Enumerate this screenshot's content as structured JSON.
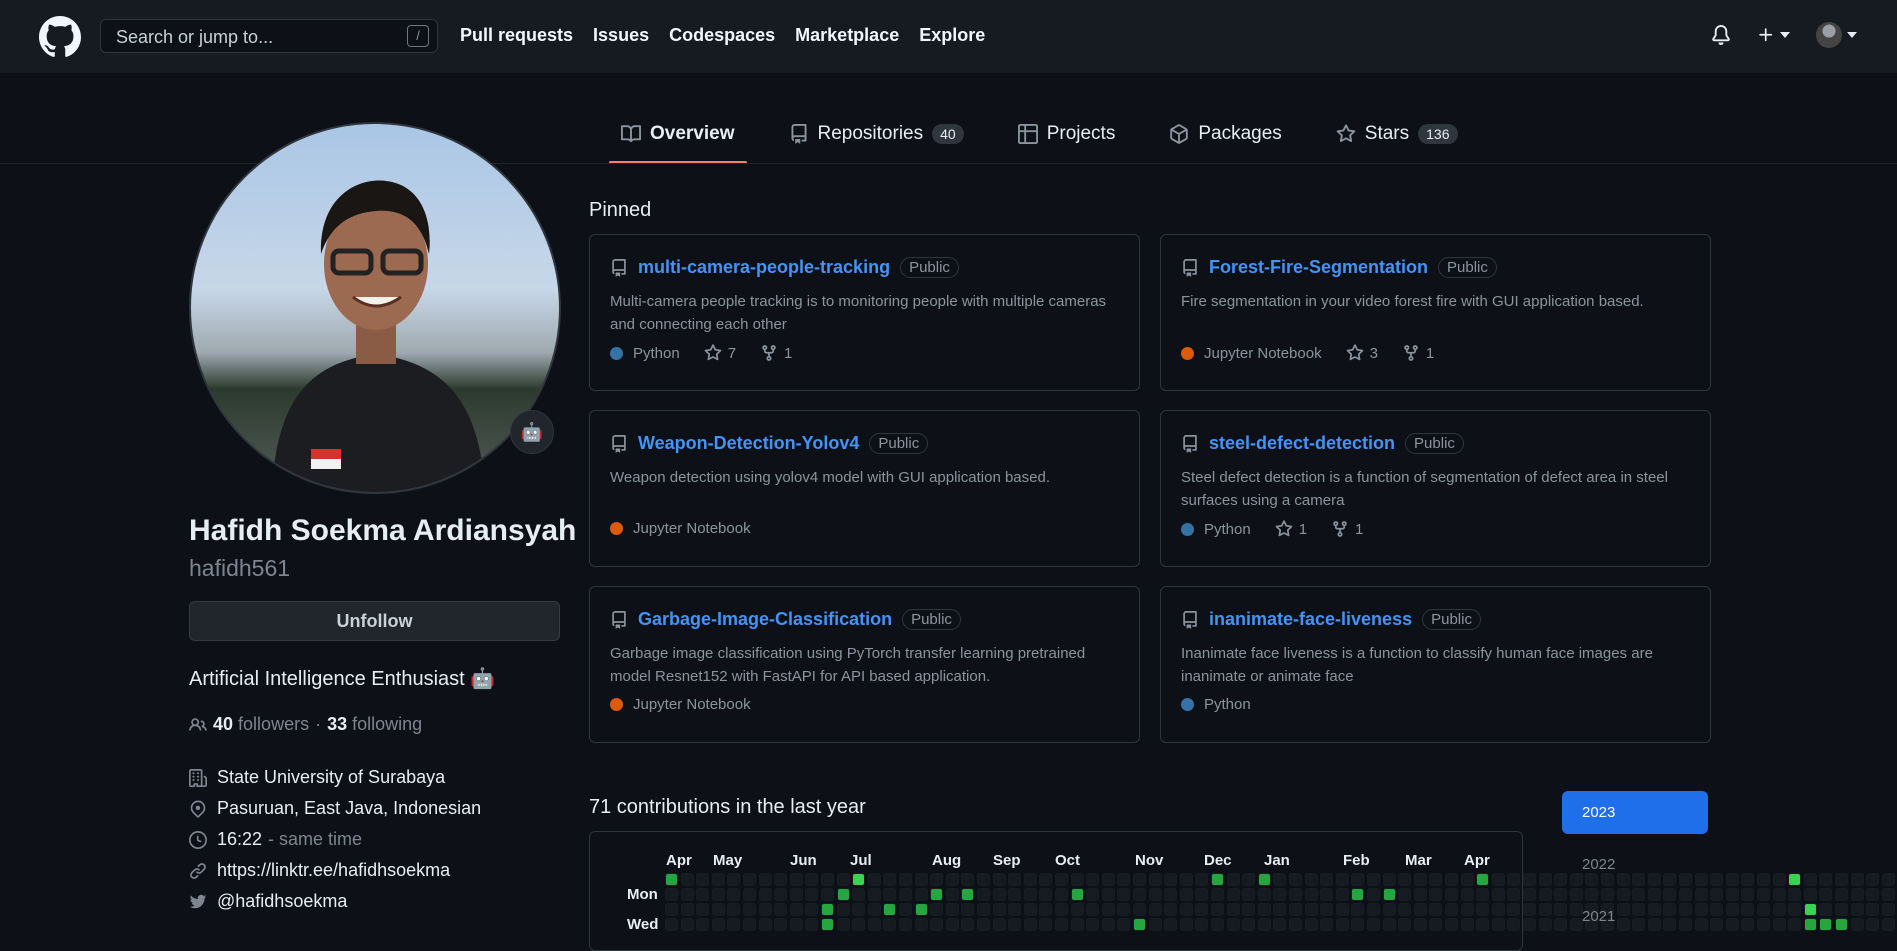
{
  "header": {
    "search_placeholder": "Search or jump to...",
    "search_key": "/",
    "nav": [
      "Pull requests",
      "Issues",
      "Codespaces",
      "Marketplace",
      "Explore"
    ]
  },
  "tabs": [
    {
      "label": "Overview",
      "icon": "book-icon"
    },
    {
      "label": "Repositories",
      "count": "40",
      "icon": "repo-icon"
    },
    {
      "label": "Projects",
      "icon": "table-icon"
    },
    {
      "label": "Packages",
      "icon": "package-icon"
    },
    {
      "label": "Stars",
      "count": "136",
      "icon": "star-icon"
    }
  ],
  "profile": {
    "name": "Hafidh Soekma Ardiansyah",
    "username": "hafidh561",
    "follow_button": "Unfollow",
    "bio": "Artificial Intelligence Enthusiast 🤖",
    "followers_count": "40",
    "followers_label": "followers",
    "separator": "·",
    "following_count": "33",
    "following_label": "following",
    "organization": "State University of Surabaya",
    "location": "Pasuruan, East Java, Indonesian",
    "local_time": "16:22",
    "time_note": "- same time",
    "website": "https://linktr.ee/hafidhsoekma",
    "twitter": "@hafidhsoekma"
  },
  "pinned": {
    "title": "Pinned",
    "repos": [
      {
        "name": "multi-camera-people-tracking",
        "visibility": "Public",
        "description": "Multi-camera people tracking is to monitoring people with multiple cameras and connecting each other",
        "language": "Python",
        "lang_color": "#3572A5",
        "stars": "7",
        "forks": "1"
      },
      {
        "name": "Forest-Fire-Segmentation",
        "visibility": "Public",
        "description": "Fire segmentation in your video forest fire with GUI application based.",
        "language": "Jupyter Notebook",
        "lang_color": "#DA5B0B",
        "stars": "3",
        "forks": "1"
      },
      {
        "name": "Weapon-Detection-Yolov4",
        "visibility": "Public",
        "description": "Weapon detection using yolov4 model with GUI application based.",
        "language": "Jupyter Notebook",
        "lang_color": "#DA5B0B",
        "stars": "",
        "forks": ""
      },
      {
        "name": "steel-defect-detection",
        "visibility": "Public",
        "description": "Steel defect detection is a function of segmentation of defect area in steel surfaces using a camera",
        "language": "Python",
        "lang_color": "#3572A5",
        "stars": "1",
        "forks": "1"
      },
      {
        "name": "Garbage-Image-Classification",
        "visibility": "Public",
        "description": "Garbage image classification using PyTorch transfer learning pretrained model Resnet152 with FastAPI for API based application.",
        "language": "Jupyter Notebook",
        "lang_color": "#DA5B0B",
        "stars": "",
        "forks": ""
      },
      {
        "name": "inanimate-face-liveness",
        "visibility": "Public",
        "description": "Inanimate face liveness is a function to classify human face images are inanimate or animate face",
        "language": "Python",
        "lang_color": "#3572A5",
        "stars": "",
        "forks": ""
      }
    ]
  },
  "contributions": {
    "title": "71 contributions in the last year",
    "months": [
      "Apr",
      "May",
      "Jun",
      "Jul",
      "Aug",
      "Sep",
      "Oct",
      "Nov",
      "Dec",
      "Jan",
      "Feb",
      "Mar",
      "Apr"
    ],
    "days": [
      "Mon",
      "Wed"
    ],
    "years": [
      "2023",
      "2022",
      "2021"
    ],
    "colors": {
      "empty": "#161b22",
      "l1": "#0e4429",
      "l2": "#006d32",
      "l3": "#26a641",
      "l4": "#39d353"
    }
  }
}
